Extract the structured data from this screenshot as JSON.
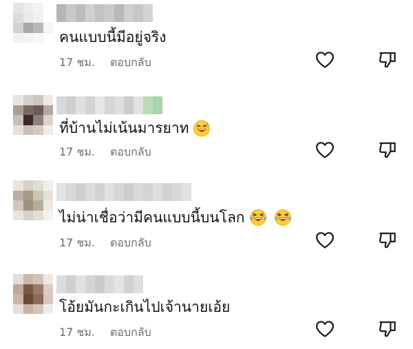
{
  "comments": [
    {
      "text": "คนแบบนี้มีอยู่จริง",
      "time": "17 ชม.",
      "reply": "ตอบกลับ",
      "emojis": [],
      "avatar": [
        "#e4e4e4",
        "#ededed",
        "#f3f3f3",
        "#ffffff",
        "#dcdcdc",
        "#e9e9e9",
        "#f0f0f0",
        "#ffffff",
        "#d2d2d2",
        "#a9a9a9",
        "#b8b8b8",
        "#f4f4f4",
        "#f1f1f1",
        "#f4f4f4",
        "#f7f7f7",
        "#ffffff"
      ],
      "username": [
        "#b5b5b5",
        "#c9c9c9",
        "#bdbdbd",
        "#d0d0d0",
        "#c3c3c3",
        "#cacaca",
        "#b9b9b9",
        "#cfcfcf",
        "#c6c6c6",
        "#d4d4d4"
      ]
    },
    {
      "text": "ที่บ้านไม่เน้นมารยาท",
      "time": "17 ชม.",
      "reply": "ตอบกลับ",
      "emojis": [
        "sweat-smile-emoji"
      ],
      "avatar": [
        "#e9e4e2",
        "#d7cfcb",
        "#cfc6c2",
        "#ede9e6",
        "#a99e98",
        "#7a6a63",
        "#6b5b56",
        "#b3a8a3",
        "#c8bfbb",
        "#3a2a28",
        "#8d7f7a",
        "#d9d2cf",
        "#e6e0dd",
        "#c9c0bb",
        "#d2cac6",
        "#f0ecea"
      ],
      "username": [
        "#d9d9d9",
        "#cfcfcf",
        "#e0e0e0",
        "#d3d3d3",
        "#e6e6e6",
        "#d6d6d6",
        "#dedede",
        "#cccccc",
        "#e2e2e2",
        "#b8dcb8",
        "#a9d6a9"
      ]
    },
    {
      "text": "ไม่น่าเชื่อว่ามีคนแบบนี้บนโลก",
      "time": "17 ชม.",
      "reply": "ตอบกลับ",
      "emojis": [
        "laugh-cry-emoji",
        "laugh-cry-emoji"
      ],
      "avatar": [
        "#e8e5df",
        "#d6d0c6",
        "#e2ddd4",
        "#f1efea",
        "#b9b0a2",
        "#a59987",
        "#cdc4b6",
        "#e6e2da",
        "#cfc7ba",
        "#9e927f",
        "#b8ad9c",
        "#ece8e1",
        "#e9e5de",
        "#d8d1c5",
        "#e3ded6",
        "#f4f2ee"
      ],
      "username": [
        "#e3e3e3",
        "#d8d8d8",
        "#cfcfcf",
        "#dcdcdc",
        "#d2d2d2",
        "#e0e0e0",
        "#d6d6d6",
        "#cdcdcd",
        "#dadada",
        "#d4d4d4",
        "#dedede",
        "#d1d1d1",
        "#d9d9d9",
        "#e1e1e1"
      ]
    },
    {
      "text": "โอ้ยมันกะเกินไปเจ้านายเอ้ย",
      "time": "17 ชม.",
      "reply": "ตอบกลับ",
      "emojis": [],
      "avatar": [
        "#e6ddd8",
        "#cbb7ab",
        "#d5c3b8",
        "#eee8e4",
        "#c1a797",
        "#7b5a45",
        "#9a7a66",
        "#dccbc1",
        "#cdb5a7",
        "#6e4b37",
        "#8a6a57",
        "#d9c7bc",
        "#e8dfda",
        "#c9b4a7",
        "#d6c5bb",
        "#f2ece8"
      ],
      "username": [
        "#dcdcdc",
        "#d0d0d0",
        "#e2e2e2",
        "#d5d5d5",
        "#cbcbcb",
        "#dadada",
        "#e4e4e4",
        "#d2d2d2",
        "#dedede"
      ]
    }
  ],
  "icons": {
    "like": "heart-icon",
    "dislike": "thumbs-down-icon"
  }
}
